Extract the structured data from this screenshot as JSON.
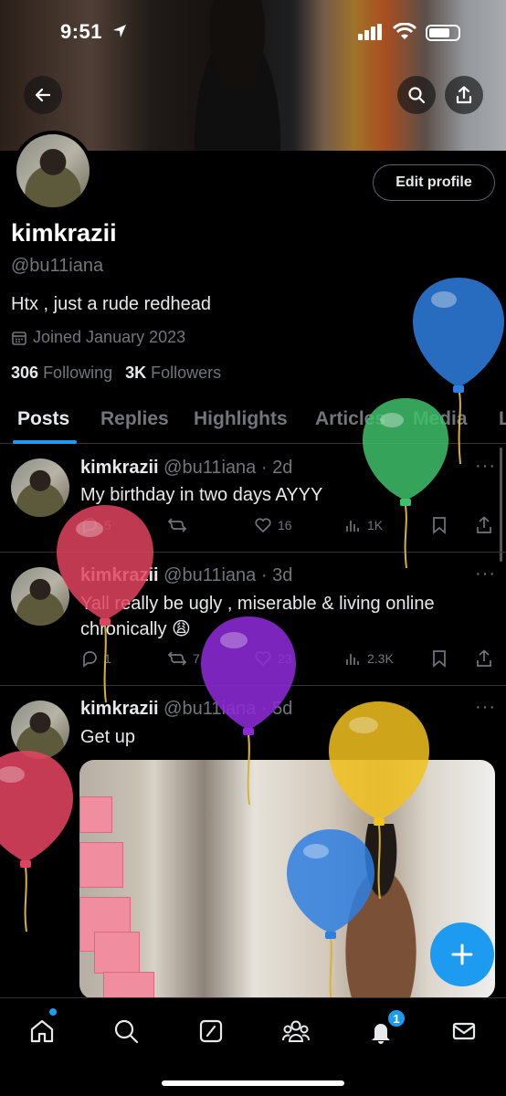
{
  "status_bar": {
    "time": "9:51"
  },
  "profile": {
    "edit_button": "Edit profile",
    "display_name": "kimkrazii",
    "handle": "@bu11iana",
    "bio": "Htx , just a rude redhead",
    "joined": "Joined January 2023",
    "following_count": "306",
    "following_label": "Following",
    "followers_count": "3K",
    "followers_label": "Followers"
  },
  "tabs": [
    {
      "label": "Posts",
      "active": true
    },
    {
      "label": "Replies"
    },
    {
      "label": "Highlights"
    },
    {
      "label": "Articles"
    },
    {
      "label": "Media"
    },
    {
      "label": "L"
    }
  ],
  "posts": [
    {
      "name": "kimkrazii",
      "handle": "@bu11iana · 2d",
      "text": "My birthday in two days AYYY",
      "replies": "5",
      "reposts": "",
      "likes": "16",
      "views": "1K"
    },
    {
      "name": "kimkrazii",
      "handle": "@bu11iana · 3d",
      "text": "Yall really be ugly , miserable & living online chronically 😩",
      "replies": "1",
      "reposts": "7",
      "likes": "23",
      "views": "2.3K"
    },
    {
      "name": "kimkrazii",
      "handle": "@bu11iana · 5d",
      "text": "Get up"
    }
  ],
  "nav": {
    "notifications_badge": "1"
  },
  "colors": {
    "accent": "#1d9bf0",
    "background": "#000000",
    "muted": "#71767b"
  },
  "balloons": [
    "blue",
    "green",
    "red",
    "purple",
    "yellow",
    "red",
    "blue"
  ]
}
